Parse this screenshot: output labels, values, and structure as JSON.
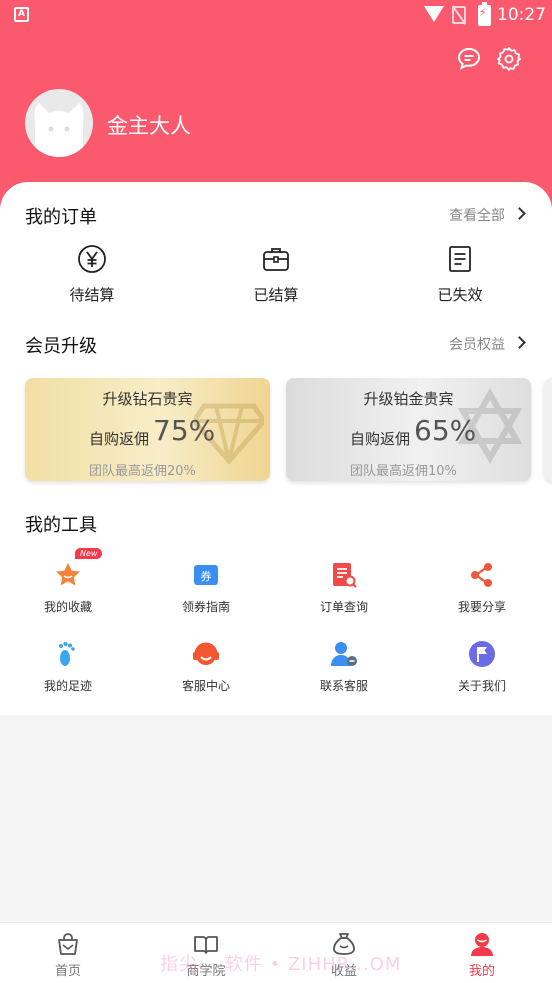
{
  "status": {
    "time": "10:27",
    "app_badge": "A"
  },
  "profile": {
    "name": "金主大人"
  },
  "orders": {
    "title": "我的订单",
    "view_all": "查看全部",
    "items": [
      {
        "label": "待结算",
        "icon": "yen-coin-icon"
      },
      {
        "label": "已结算",
        "icon": "briefcase-icon"
      },
      {
        "label": "已失效",
        "icon": "document-icon"
      }
    ]
  },
  "membership": {
    "title": "会员升级",
    "benefits": "会员权益",
    "cards": [
      {
        "title": "升级钻石贵宾",
        "rate_label": "自购返佣",
        "rate": "75%",
        "team": "团队最高返佣20%",
        "icon": "diamond-icon"
      },
      {
        "title": "升级铂金贵宾",
        "rate_label": "自购返佣",
        "rate": "65%",
        "team": "团队最高返佣10%",
        "icon": "star-of-david-icon"
      }
    ]
  },
  "tools": {
    "title": "我的工具",
    "new_badge": "New",
    "items": [
      {
        "label": "我的收藏",
        "icon": "star-icon"
      },
      {
        "label": "领券指南",
        "icon": "coupon-icon"
      },
      {
        "label": "订单查询",
        "icon": "order-search-icon"
      },
      {
        "label": "我要分享",
        "icon": "share-icon"
      },
      {
        "label": "我的足迹",
        "icon": "footprint-icon"
      },
      {
        "label": "客服中心",
        "icon": "headset-icon"
      },
      {
        "label": "联系客服",
        "icon": "contact-icon"
      },
      {
        "label": "关于我们",
        "icon": "flag-icon"
      }
    ]
  },
  "tabbar": {
    "items": [
      {
        "label": "首页",
        "icon": "shopping-bag-icon"
      },
      {
        "label": "商学院",
        "icon": "book-icon"
      },
      {
        "label": "收益",
        "icon": "money-bag-icon"
      },
      {
        "label": "我的",
        "icon": "user-icon",
        "active": true
      }
    ]
  },
  "watermark": "指尖... 软件 • ZIHHR...OM",
  "colors": {
    "brand": "#fb5a6e",
    "accent": "#f43a4a"
  }
}
